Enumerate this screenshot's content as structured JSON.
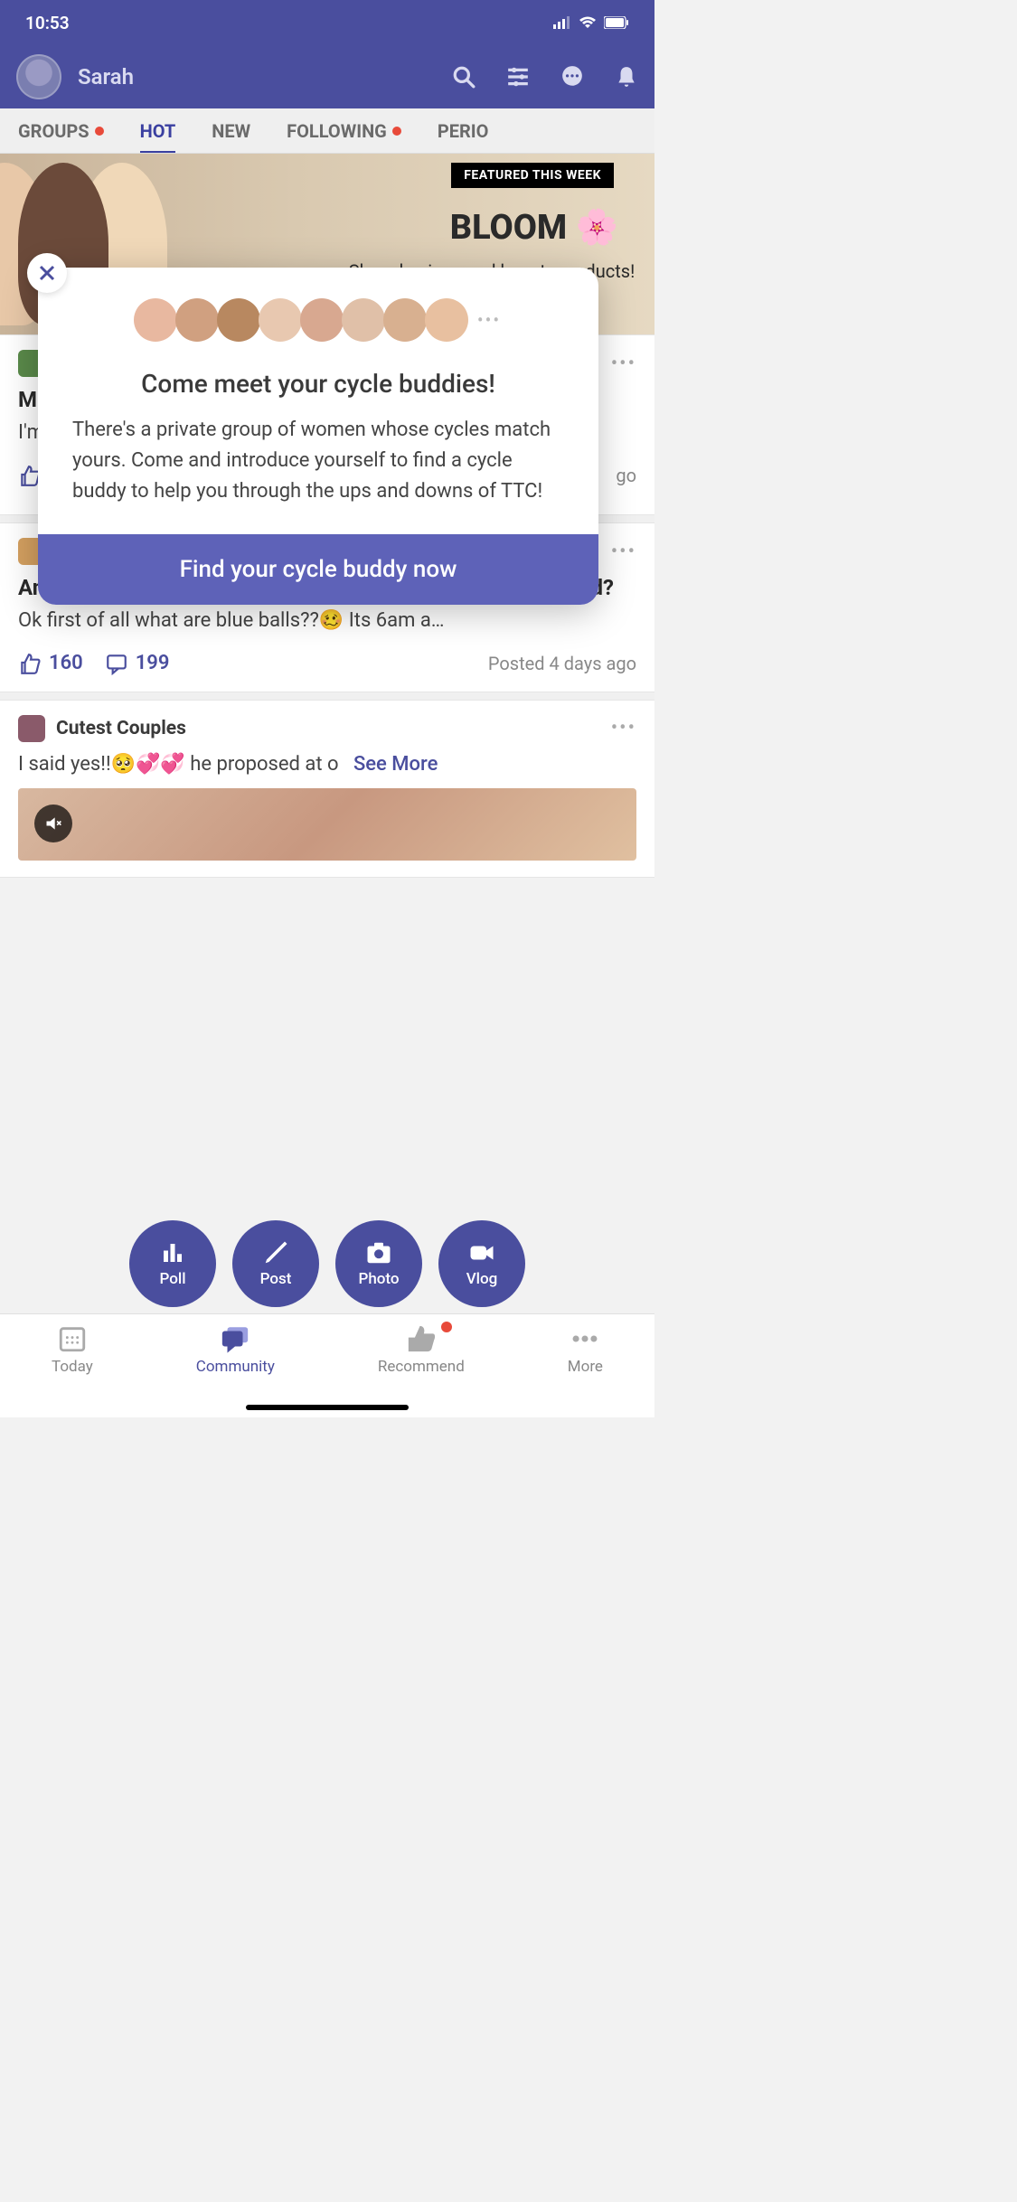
{
  "status": {
    "time": "10:53"
  },
  "header": {
    "user_name": "Sarah"
  },
  "tabs": [
    {
      "label": "GROUPS",
      "dot": true,
      "active": false
    },
    {
      "label": "HOT",
      "dot": false,
      "active": true
    },
    {
      "label": "NEW",
      "dot": false,
      "active": false
    },
    {
      "label": "FOLLOWING",
      "dot": true,
      "active": false
    },
    {
      "label": "PERIO",
      "dot": false,
      "active": false
    }
  ],
  "banner": {
    "badge": "FEATURED THIS WEEK",
    "title": "BLOOM 🌸",
    "subtitle": "Share hygiene and beauty products!"
  },
  "posts": [
    {
      "title_partial": "M…",
      "body_partial": "I'm                                                                                                     ar old …",
      "time_partial": "go"
    },
    {
      "title": "Am I allowed to say no to SEX even if my man is in the mood?",
      "body": "Ok first of all what are blue balls??🥴 Its 6am a…",
      "likes": "160",
      "comments": "199",
      "time": "Posted 4 days ago"
    },
    {
      "group": "Cutest Couples",
      "body_prefix": "I said yes!!🥺💞💞 he proposed at o",
      "see_more": "See More"
    }
  ],
  "fabs": [
    {
      "label": "Poll"
    },
    {
      "label": "Post"
    },
    {
      "label": "Photo"
    },
    {
      "label": "Vlog"
    }
  ],
  "bottom_nav": [
    {
      "label": "Today",
      "active": false,
      "badge": false
    },
    {
      "label": "Community",
      "active": true,
      "badge": false
    },
    {
      "label": "Recommend",
      "active": false,
      "badge": true
    },
    {
      "label": "More",
      "active": false,
      "badge": false
    }
  ],
  "modal": {
    "title": "Come meet your cycle buddies!",
    "body": "There's a private group of women whose cycles match yours. Come and introduce yourself to find a cycle buddy to help you through the ups and downs of TTC!",
    "cta": "Find your cycle buddy now"
  }
}
